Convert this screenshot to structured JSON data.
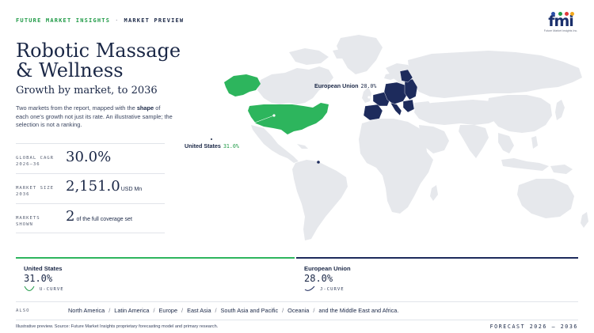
{
  "header": {
    "brand": "FUTURE MARKET INSIGHTS",
    "separator": "·",
    "section": "MARKET PREVIEW"
  },
  "logo": {
    "letters": "fmi",
    "tagline": "Future Market Insights Inc.",
    "dot_colors": [
      "#2a4fa8",
      "#1f9a46",
      "#e03a3a",
      "#f2a81d"
    ]
  },
  "title": "Robotic Massage & Wellness",
  "subtitle": "Growth by market, to 2036",
  "description": {
    "before": "Two markets from the report, mapped with the ",
    "bold": "shape",
    "after": " of each one's growth not just its rate. An illustrative sample; the selection is not a ranking."
  },
  "stats": [
    {
      "label_line1": "GLOBAL CAGR",
      "label_line2": "2026–36",
      "value": "30.0%",
      "unit": ""
    },
    {
      "label_line1": "MARKET SIZE",
      "label_line2": "2036",
      "value": "2,151.0",
      "unit": "USD Mn"
    },
    {
      "label_line1": "MARKETS",
      "label_line2": "SHOWN",
      "value": "2",
      "unit": "of the full coverage set"
    }
  ],
  "map": {
    "colors": {
      "land": "#e6e8ec",
      "us": "#2db55d",
      "eu": "#1d2b5c",
      "ocean": "#ffffff"
    },
    "callouts": [
      {
        "region": "United States",
        "value": "31.0%"
      },
      {
        "region": "European Union",
        "value": "28.0%"
      }
    ]
  },
  "markets": [
    {
      "name": "United States",
      "value": "31.0%",
      "curve": "U-CURVE",
      "color": "#2db55d"
    },
    {
      "name": "European Union",
      "value": "28.0%",
      "curve": "J-CURVE",
      "color": "#1d2b5c"
    }
  ],
  "also": {
    "label": "ALSO",
    "regions": [
      "North America",
      "Latin America",
      "Europe",
      "East Asia",
      "South Asia and Pacific",
      "Oceania",
      "and the Middle East and Africa."
    ],
    "separator": "/"
  },
  "footnote": "Illustrative preview. Source: Future Market Insights proprietary forecasting model and primary research.",
  "forecast": "FORECAST 2026 – 2036"
}
